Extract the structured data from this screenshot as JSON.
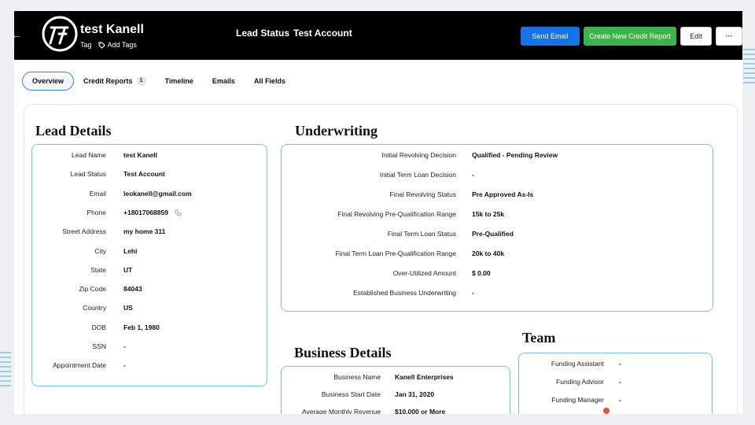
{
  "header": {
    "lead_name": "test Kanell",
    "tag_label": "Tag",
    "add_tags_label": "Add Tags",
    "status_label": "Lead Status",
    "status_value": "Test Account",
    "buttons": {
      "send_email": "Send Email",
      "create_credit_report": "Create New Credit Report",
      "edit": "Edit",
      "more": "···"
    }
  },
  "tabs": [
    {
      "label": "Overview",
      "active": true
    },
    {
      "label": "Credit Reports",
      "badge": "1"
    },
    {
      "label": "Timeline"
    },
    {
      "label": "Emails"
    },
    {
      "label": "All Fields"
    }
  ],
  "lead_details": {
    "title": "Lead Details",
    "rows": [
      {
        "key": "Lead Name",
        "value": "test Kanell"
      },
      {
        "key": "Lead Status",
        "value": "Test Account"
      },
      {
        "key": "Email",
        "value": "leokanell@gmail.com"
      },
      {
        "key": "Phone",
        "value": "+18017068859"
      },
      {
        "key": "Street Address",
        "value": "my home 311"
      },
      {
        "key": "City",
        "value": "Lehi"
      },
      {
        "key": "State",
        "value": "UT"
      },
      {
        "key": "Zip Code",
        "value": "84043"
      },
      {
        "key": "Country",
        "value": "US"
      },
      {
        "key": "DOB",
        "value": "Feb 1, 1980"
      },
      {
        "key": "SSN",
        "value": "-"
      },
      {
        "key": "Appointment Date",
        "value": "-"
      }
    ]
  },
  "underwriting": {
    "title": "Underwriting",
    "rows": [
      {
        "key": "Initial Revolving Decision",
        "value": "Qualified - Pending Review"
      },
      {
        "key": "Initial Term Loan Decision",
        "value": "-"
      },
      {
        "key": "Final Revolving Status",
        "value": "Pre Approved As-Is"
      },
      {
        "key": "Final Revolving Pre-Qualification Range",
        "value": "15k to 25k"
      },
      {
        "key": "Final Term Loan Status",
        "value": "Pre-Qualified"
      },
      {
        "key": "Final Term Loan Pre-Qualification Range",
        "value": "20k to 40k"
      },
      {
        "key": "Over-Utilized Amount",
        "value": "$ 0.00"
      },
      {
        "key": "Established Business Underwriting",
        "value": "-"
      }
    ]
  },
  "business_details": {
    "title": "Business Details",
    "rows": [
      {
        "key": "Business Name",
        "value": "Kanell Enterprises"
      },
      {
        "key": "Business Start Date",
        "value": "Jan 31, 2020"
      },
      {
        "key": "Average Monthly Revenue",
        "value": "$10,000 or More"
      }
    ]
  },
  "team": {
    "title": "Team",
    "rows": [
      {
        "key": "Funding Assistant",
        "value": "-"
      },
      {
        "key": "Funding Advisor",
        "value": "-"
      },
      {
        "key": "Funding Manager",
        "value": "-"
      }
    ]
  },
  "colors": {
    "accent_blue": "#1473e6",
    "accent_green": "#3cb44b",
    "panel_border": "#6ec5e9",
    "header_bg": "#000000"
  }
}
